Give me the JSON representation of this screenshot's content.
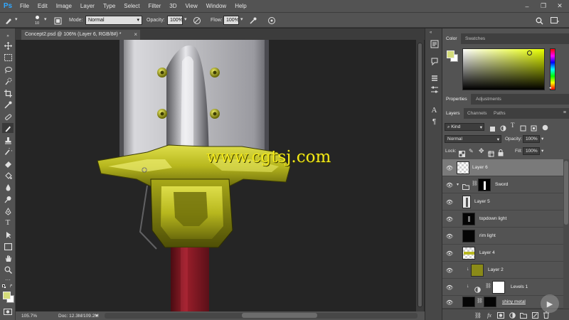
{
  "app": {
    "logo": "Ps",
    "menu": [
      "File",
      "Edit",
      "Image",
      "Layer",
      "Type",
      "Select",
      "Filter",
      "3D",
      "View",
      "Window",
      "Help"
    ],
    "window_controls": [
      "–",
      "❐",
      "✕"
    ]
  },
  "options_bar": {
    "brush_size": "10",
    "mode_label": "Mode:",
    "mode_value": "Normal",
    "opacity_label": "Opacity:",
    "opacity_value": "100%",
    "flow_label": "Flow:",
    "flow_value": "100%"
  },
  "document": {
    "tab_title": "Concept2.psd @ 106% (Layer 6, RGB/8#) *",
    "watermark": "www.cgtsj.com"
  },
  "status_bar": {
    "zoom": "105.7%",
    "doc_size": "Doc: 12.3M/109.2M"
  },
  "color_panel": {
    "tabs": [
      "Color",
      "Swatches"
    ],
    "foreground": "#d4dc7a",
    "background": "#ffffff",
    "hue_color": "#e8ff00"
  },
  "properties_panel": {
    "tabs": [
      "Properties",
      "Adjustments"
    ]
  },
  "layers_panel": {
    "tabs": [
      "Layers",
      "Channels",
      "Paths"
    ],
    "kind_label": "Kind",
    "blend_mode": "Normal",
    "opacity_label": "Opacity:",
    "opacity_value": "100%",
    "lock_label": "Lock:",
    "fill_label": "Fill:",
    "fill_value": "100%",
    "layers": [
      {
        "name": "Layer 6",
        "selected": true
      },
      {
        "name": "Sword",
        "group": true
      },
      {
        "name": "Layer 5"
      },
      {
        "name": "topdown light"
      },
      {
        "name": "rim light"
      },
      {
        "name": "Layer 4"
      },
      {
        "name": "Layer 2"
      },
      {
        "name": "Levels 1"
      },
      {
        "name": "shiny metal"
      }
    ]
  }
}
